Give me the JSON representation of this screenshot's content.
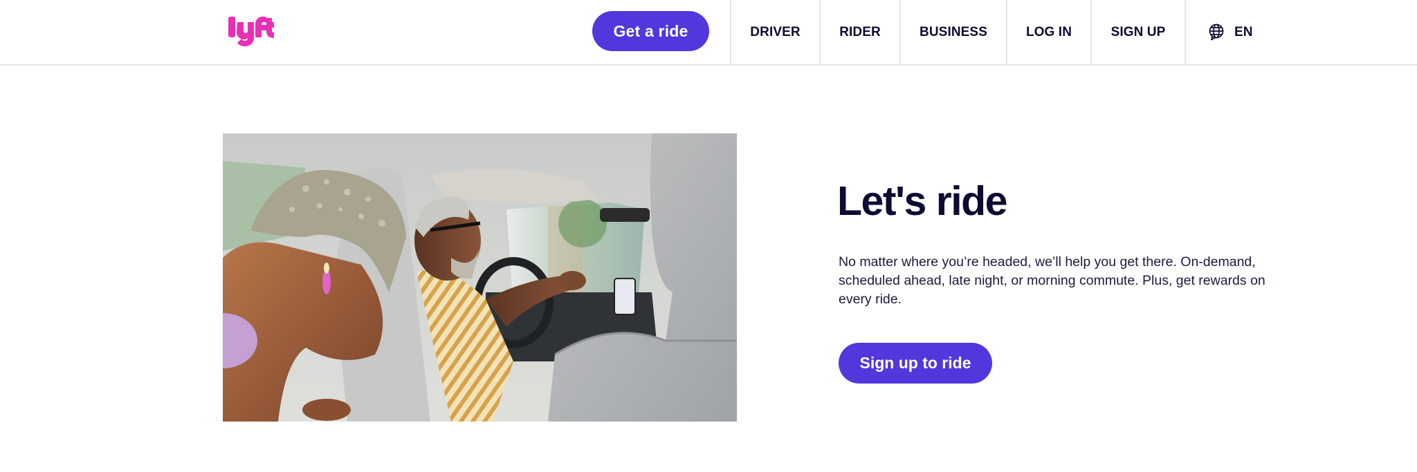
{
  "header": {
    "logo_text": "lyft",
    "brand_color": "#ea2fb6",
    "accent_color": "#5137dc",
    "get_ride_label": "Get a ride",
    "nav": [
      {
        "label": "DRIVER"
      },
      {
        "label": "RIDER"
      },
      {
        "label": "BUSINESS"
      },
      {
        "label": "LOG IN"
      },
      {
        "label": "SIGN UP"
      }
    ],
    "language": {
      "icon": "globe-icon",
      "label": "EN"
    }
  },
  "hero": {
    "image_alt": "Smiling passenger leaning forward in the back seat while a driver in a striped shirt laughs at the wheel",
    "title": "Let's ride",
    "body": "No matter where you’re headed, we’ll help you get there. On-demand, scheduled ahead, late night, or morning commute. Plus, get rewards on every ride.",
    "cta_label": "Sign up to ride"
  }
}
